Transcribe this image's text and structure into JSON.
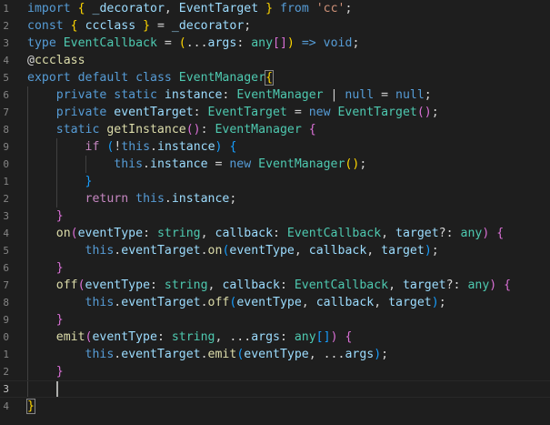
{
  "editor": {
    "language": "typescript",
    "line_numbers": [
      "1",
      "2",
      "3",
      "4",
      "5",
      "6",
      "7",
      "8",
      "9",
      "0",
      "1",
      "2",
      "3",
      "4",
      "5",
      "6",
      "7",
      "8",
      "9",
      "0",
      "1",
      "2",
      "3",
      "4"
    ],
    "current_line": 23,
    "lines": [
      [
        [
          "kw",
          "import"
        ],
        [
          "pl",
          " "
        ],
        [
          "b1",
          "{"
        ],
        [
          "pl",
          " "
        ],
        [
          "var",
          "_decorator"
        ],
        [
          "pl",
          ", "
        ],
        [
          "var",
          "EventTarget"
        ],
        [
          "pl",
          " "
        ],
        [
          "b1",
          "}"
        ],
        [
          "pl",
          " "
        ],
        [
          "kw",
          "from"
        ],
        [
          "pl",
          " "
        ],
        [
          "str",
          "'cc'"
        ],
        [
          "pl",
          ";"
        ]
      ],
      [
        [
          "kw",
          "const"
        ],
        [
          "pl",
          " "
        ],
        [
          "b1",
          "{"
        ],
        [
          "pl",
          " "
        ],
        [
          "var",
          "ccclass"
        ],
        [
          "pl",
          " "
        ],
        [
          "b1",
          "}"
        ],
        [
          "pl",
          " = "
        ],
        [
          "var",
          "_decorator"
        ],
        [
          "pl",
          ";"
        ]
      ],
      [
        [
          "kw",
          "type"
        ],
        [
          "pl",
          " "
        ],
        [
          "ty",
          "EventCallback"
        ],
        [
          "pl",
          " = "
        ],
        [
          "b1",
          "("
        ],
        [
          "pl",
          "..."
        ],
        [
          "var",
          "args"
        ],
        [
          "pl",
          ": "
        ],
        [
          "ty",
          "any"
        ],
        [
          "b2",
          "[]"
        ],
        [
          "b1",
          ")"
        ],
        [
          "pl",
          " "
        ],
        [
          "kw",
          "=>"
        ],
        [
          "pl",
          " "
        ],
        [
          "kw",
          "void"
        ],
        [
          "pl",
          ";"
        ]
      ],
      [
        [
          "pl",
          "@"
        ],
        [
          "fn",
          "ccclass"
        ]
      ],
      [
        [
          "kw",
          "export"
        ],
        [
          "pl",
          " "
        ],
        [
          "kw",
          "default"
        ],
        [
          "pl",
          " "
        ],
        [
          "kw",
          "class"
        ],
        [
          "pl",
          " "
        ],
        [
          "ty",
          "EventManager"
        ],
        [
          "b1",
          "{"
        ]
      ],
      [
        [
          "pl",
          "    "
        ],
        [
          "kw",
          "private"
        ],
        [
          "pl",
          " "
        ],
        [
          "kw",
          "static"
        ],
        [
          "pl",
          " "
        ],
        [
          "var",
          "instance"
        ],
        [
          "pl",
          ": "
        ],
        [
          "ty",
          "EventManager"
        ],
        [
          "pl",
          " | "
        ],
        [
          "kw",
          "null"
        ],
        [
          "pl",
          " = "
        ],
        [
          "kw",
          "null"
        ],
        [
          "pl",
          ";"
        ]
      ],
      [
        [
          "pl",
          "    "
        ],
        [
          "kw",
          "private"
        ],
        [
          "pl",
          " "
        ],
        [
          "var",
          "eventTarget"
        ],
        [
          "pl",
          ": "
        ],
        [
          "ty",
          "EventTarget"
        ],
        [
          "pl",
          " = "
        ],
        [
          "kw",
          "new"
        ],
        [
          "pl",
          " "
        ],
        [
          "ty",
          "EventTarget"
        ],
        [
          "b2",
          "()"
        ],
        [
          "pl",
          ";"
        ]
      ],
      [
        [
          "pl",
          "    "
        ],
        [
          "kw",
          "static"
        ],
        [
          "pl",
          " "
        ],
        [
          "fn",
          "getInstance"
        ],
        [
          "b2",
          "()"
        ],
        [
          "pl",
          ": "
        ],
        [
          "ty",
          "EventManager"
        ],
        [
          "pl",
          " "
        ],
        [
          "b2",
          "{"
        ]
      ],
      [
        [
          "pl",
          "        "
        ],
        [
          "ctl",
          "if"
        ],
        [
          "pl",
          " "
        ],
        [
          "b3",
          "("
        ],
        [
          "pl",
          "!"
        ],
        [
          "kw",
          "this"
        ],
        [
          "pl",
          "."
        ],
        [
          "var",
          "instance"
        ],
        [
          "b3",
          ")"
        ],
        [
          "pl",
          " "
        ],
        [
          "b3",
          "{"
        ]
      ],
      [
        [
          "pl",
          "            "
        ],
        [
          "kw",
          "this"
        ],
        [
          "pl",
          "."
        ],
        [
          "var",
          "instance"
        ],
        [
          "pl",
          " = "
        ],
        [
          "kw",
          "new"
        ],
        [
          "pl",
          " "
        ],
        [
          "ty",
          "EventManager"
        ],
        [
          "b1",
          "()"
        ],
        [
          "pl",
          ";"
        ]
      ],
      [
        [
          "pl",
          "        "
        ],
        [
          "b3",
          "}"
        ]
      ],
      [
        [
          "pl",
          "        "
        ],
        [
          "ctl",
          "return"
        ],
        [
          "pl",
          " "
        ],
        [
          "kw",
          "this"
        ],
        [
          "pl",
          "."
        ],
        [
          "var",
          "instance"
        ],
        [
          "pl",
          ";"
        ]
      ],
      [
        [
          "pl",
          "    "
        ],
        [
          "b2",
          "}"
        ]
      ],
      [
        [
          "pl",
          "    "
        ],
        [
          "fn",
          "on"
        ],
        [
          "b2",
          "("
        ],
        [
          "var",
          "eventType"
        ],
        [
          "pl",
          ": "
        ],
        [
          "ty",
          "string"
        ],
        [
          "pl",
          ", "
        ],
        [
          "var",
          "callback"
        ],
        [
          "pl",
          ": "
        ],
        [
          "ty",
          "EventCallback"
        ],
        [
          "pl",
          ", "
        ],
        [
          "var",
          "target"
        ],
        [
          "pl",
          "?: "
        ],
        [
          "ty",
          "any"
        ],
        [
          "b2",
          ")"
        ],
        [
          "pl",
          " "
        ],
        [
          "b2",
          "{"
        ]
      ],
      [
        [
          "pl",
          "        "
        ],
        [
          "kw",
          "this"
        ],
        [
          "pl",
          "."
        ],
        [
          "var",
          "eventTarget"
        ],
        [
          "pl",
          "."
        ],
        [
          "fn",
          "on"
        ],
        [
          "b3",
          "("
        ],
        [
          "var",
          "eventType"
        ],
        [
          "pl",
          ", "
        ],
        [
          "var",
          "callback"
        ],
        [
          "pl",
          ", "
        ],
        [
          "var",
          "target"
        ],
        [
          "b3",
          ")"
        ],
        [
          "pl",
          ";"
        ]
      ],
      [
        [
          "pl",
          "    "
        ],
        [
          "b2",
          "}"
        ]
      ],
      [
        [
          "pl",
          "    "
        ],
        [
          "fn",
          "off"
        ],
        [
          "b2",
          "("
        ],
        [
          "var",
          "eventType"
        ],
        [
          "pl",
          ": "
        ],
        [
          "ty",
          "string"
        ],
        [
          "pl",
          ", "
        ],
        [
          "var",
          "callback"
        ],
        [
          "pl",
          ": "
        ],
        [
          "ty",
          "EventCallback"
        ],
        [
          "pl",
          ", "
        ],
        [
          "var",
          "target"
        ],
        [
          "pl",
          "?: "
        ],
        [
          "ty",
          "any"
        ],
        [
          "b2",
          ")"
        ],
        [
          "pl",
          " "
        ],
        [
          "b2",
          "{"
        ]
      ],
      [
        [
          "pl",
          "        "
        ],
        [
          "kw",
          "this"
        ],
        [
          "pl",
          "."
        ],
        [
          "var",
          "eventTarget"
        ],
        [
          "pl",
          "."
        ],
        [
          "fn",
          "off"
        ],
        [
          "b3",
          "("
        ],
        [
          "var",
          "eventType"
        ],
        [
          "pl",
          ", "
        ],
        [
          "var",
          "callback"
        ],
        [
          "pl",
          ", "
        ],
        [
          "var",
          "target"
        ],
        [
          "b3",
          ")"
        ],
        [
          "pl",
          ";"
        ]
      ],
      [
        [
          "pl",
          "    "
        ],
        [
          "b2",
          "}"
        ]
      ],
      [
        [
          "pl",
          "    "
        ],
        [
          "fn",
          "emit"
        ],
        [
          "b2",
          "("
        ],
        [
          "var",
          "eventType"
        ],
        [
          "pl",
          ": "
        ],
        [
          "ty",
          "string"
        ],
        [
          "pl",
          ", ..."
        ],
        [
          "var",
          "args"
        ],
        [
          "pl",
          ": "
        ],
        [
          "ty",
          "any"
        ],
        [
          "b3",
          "[]"
        ],
        [
          "b2",
          ")"
        ],
        [
          "pl",
          " "
        ],
        [
          "b2",
          "{"
        ]
      ],
      [
        [
          "pl",
          "        "
        ],
        [
          "kw",
          "this"
        ],
        [
          "pl",
          "."
        ],
        [
          "var",
          "eventTarget"
        ],
        [
          "pl",
          "."
        ],
        [
          "fn",
          "emit"
        ],
        [
          "b3",
          "("
        ],
        [
          "var",
          "eventType"
        ],
        [
          "pl",
          ", ..."
        ],
        [
          "var",
          "args"
        ],
        [
          "b3",
          ")"
        ],
        [
          "pl",
          ";"
        ]
      ],
      [
        [
          "pl",
          "    "
        ],
        [
          "b2",
          "}"
        ]
      ],
      [
        [
          "pl",
          "    "
        ]
      ],
      [
        [
          "b1",
          "}"
        ]
      ]
    ],
    "colors": {
      "background": "#1e1e1e",
      "keyword": "#569cd6",
      "control": "#c586c0",
      "type": "#4ec9b0",
      "function": "#dcdcaa",
      "variable": "#9cdcfe",
      "string": "#ce9178",
      "bracket_1": "#ffd700",
      "bracket_2": "#da70d6",
      "bracket_3": "#179fff"
    }
  }
}
